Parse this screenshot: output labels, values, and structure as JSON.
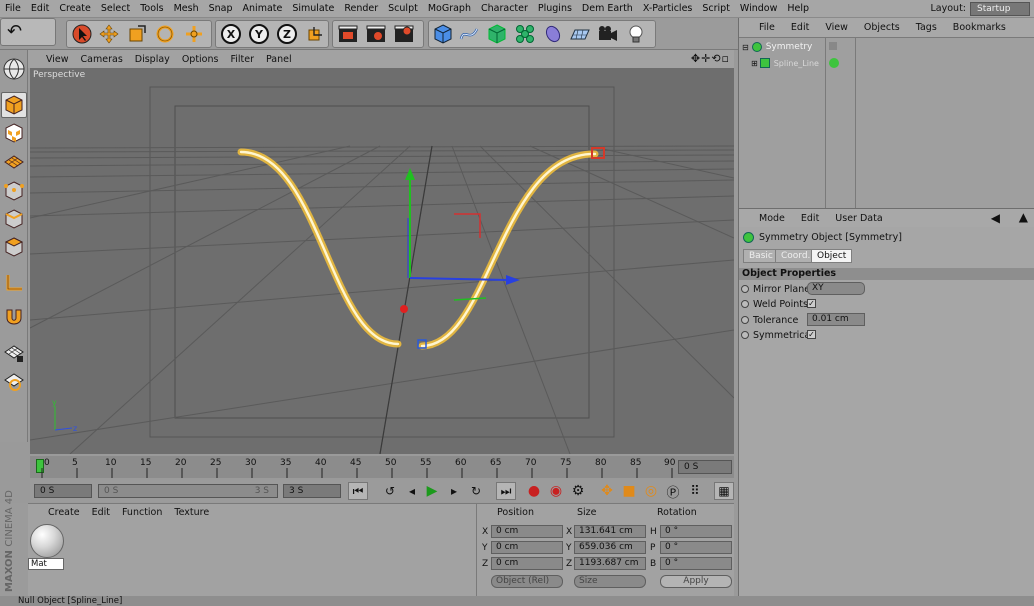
{
  "menubar": {
    "items": [
      "File",
      "Edit",
      "Create",
      "Select",
      "Tools",
      "Mesh",
      "Snap",
      "Animate",
      "Simulate",
      "Render",
      "Sculpt",
      "MoGraph",
      "Character",
      "Plugins",
      "Dem Earth",
      "X-Particles",
      "Script",
      "Window",
      "Help"
    ],
    "layout_label": "Layout:",
    "layout_value": "Startup"
  },
  "toolbar": {
    "undo_glyph": "↶",
    "axis_x": "X",
    "axis_y": "Y",
    "axis_z": "Z"
  },
  "viewport": {
    "menu": [
      "View",
      "Cameras",
      "Display",
      "Options",
      "Filter",
      "Panel"
    ],
    "label": "Perspective"
  },
  "timeline": {
    "ticks": [
      "0",
      "5",
      "10",
      "15",
      "20",
      "25",
      "30",
      "35",
      "40",
      "45",
      "50",
      "55",
      "60",
      "65",
      "70",
      "75",
      "80",
      "85",
      "90"
    ],
    "current_frame": "0 S",
    "start_field": "0 S",
    "min_field": "0 S",
    "max_field": "3 S",
    "end_field": "3 S"
  },
  "material_manager": {
    "menu": [
      "Create",
      "Edit",
      "Function",
      "Texture"
    ],
    "material_name": "Mat",
    "brand": "MAXON",
    "brand_sub": "CINEMA 4D"
  },
  "coordinates": {
    "headers": {
      "position": "Position",
      "size": "Size",
      "rotation": "Rotation"
    },
    "rows": [
      {
        "axis": "X",
        "pos": "0 cm",
        "size_axis": "X",
        "size": "131.641 cm",
        "rot_axis": "H",
        "rot": "0 °"
      },
      {
        "axis": "Y",
        "pos": "0 cm",
        "size_axis": "Y",
        "size": "659.036 cm",
        "rot_axis": "P",
        "rot": "0 °"
      },
      {
        "axis": "Z",
        "pos": "0 cm",
        "size_axis": "Z",
        "size": "1193.687 cm",
        "rot_axis": "B",
        "rot": "0 °"
      }
    ],
    "mode_select": "Object (Rel)",
    "size_select": "Size",
    "apply_label": "Apply"
  },
  "status": "Null Object [Spline_Line]",
  "object_manager": {
    "menu": [
      "File",
      "Edit",
      "View",
      "Objects",
      "Tags",
      "Bookmarks"
    ],
    "items": [
      {
        "name": "Symmetry",
        "selected": true
      },
      {
        "name": "Spline_Line",
        "selected": false
      }
    ]
  },
  "attributes": {
    "menu": [
      "Mode",
      "Edit",
      "User Data"
    ],
    "object_title": "Symmetry Object [Symmetry]",
    "tabs": [
      "Basic",
      "Coord.",
      "Object"
    ],
    "active_tab": "Object",
    "section": "Object Properties",
    "mirror_plane_label": "Mirror Plane",
    "mirror_plane_value": "XY",
    "weld_points_label": "Weld Points",
    "weld_points_check": "✓",
    "tolerance_label": "Tolerance",
    "tolerance_value": "0.01 cm",
    "symmetrical_label": "Symmetrical",
    "symmetrical_check": "✓"
  },
  "colors": {
    "accent_orange": "#e08a1a",
    "spline_glow": "#f6c23a",
    "selected_green": "#3ec43e",
    "play_green": "#1c9a1c"
  }
}
